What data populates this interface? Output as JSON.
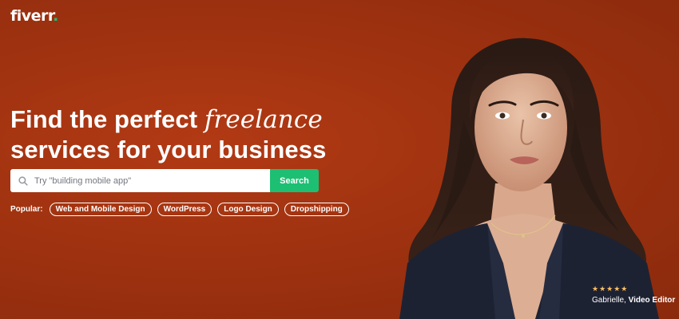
{
  "brand": {
    "logo_text": "fiverr",
    "logo_dot": ".",
    "accent_color": "#1dbf73"
  },
  "hero": {
    "headline_part1": "Find the perfect ",
    "headline_accent": "freelance",
    "headline_part2": "services for your business",
    "background_color": "#9f3210"
  },
  "search": {
    "placeholder": "Try \"building mobile app\"",
    "button_label": "Search",
    "icon": "search-icon"
  },
  "popular": {
    "label": "Popular:",
    "tags": [
      "Web and Mobile Design",
      "WordPress",
      "Logo Design",
      "Dropshipping"
    ]
  },
  "testimonial": {
    "stars": "★★★★★",
    "star_color": "#ffbe5b",
    "name": "Gabrielle,",
    "role": "Video Editor"
  }
}
